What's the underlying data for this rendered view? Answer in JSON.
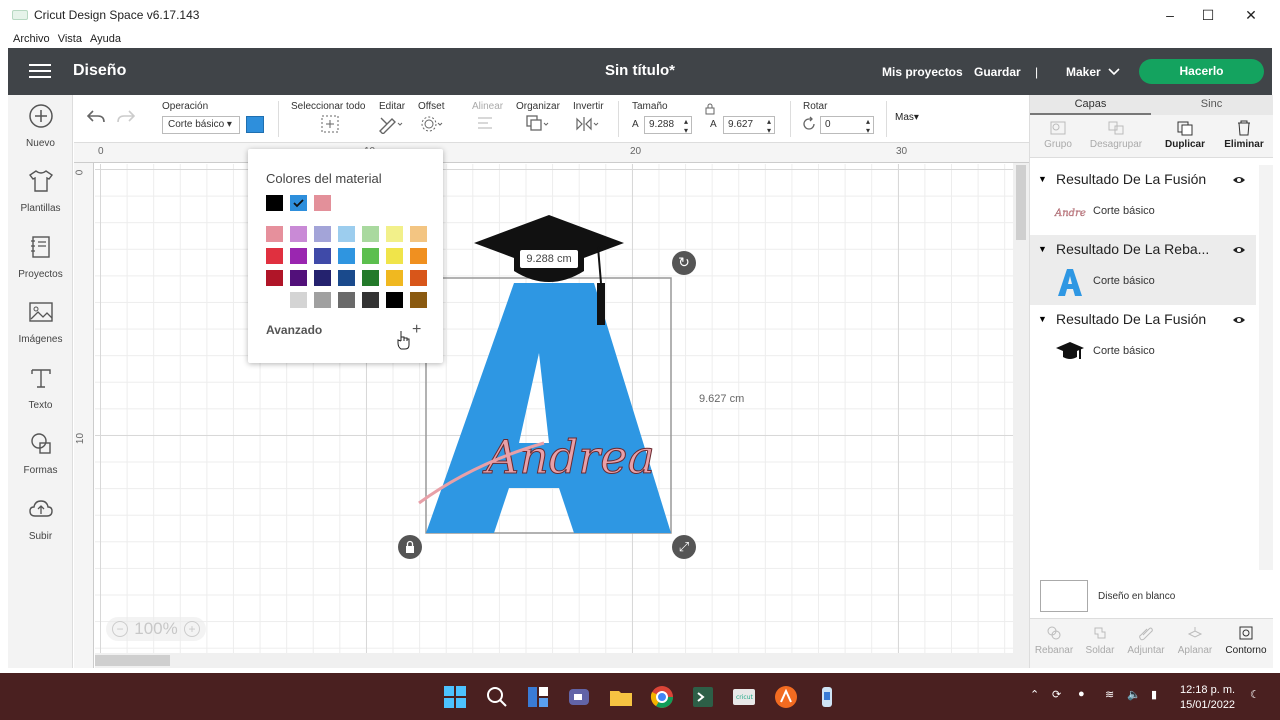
{
  "window": {
    "title": "Cricut Design Space  v6.17.143",
    "controls": [
      "minimize",
      "maximize",
      "close"
    ]
  },
  "menubar": [
    "Archivo",
    "Vista",
    "Ayuda"
  ],
  "header": {
    "section": "Diseño",
    "document_title": "Sin título*",
    "my_projects": "Mis proyectos",
    "save": "Guardar",
    "divider": "|",
    "machine": "Maker",
    "make_button": "Hacerlo",
    "accent_color": "#14a35f"
  },
  "sidebar": [
    {
      "label": "Nuevo",
      "icon": "plus-circle-icon"
    },
    {
      "label": "Plantillas",
      "icon": "shirt-icon"
    },
    {
      "label": "Proyectos",
      "icon": "notebook-icon"
    },
    {
      "label": "Imágenes",
      "icon": "image-icon"
    },
    {
      "label": "Texto",
      "icon": "text-icon"
    },
    {
      "label": "Formas",
      "icon": "shapes-icon"
    },
    {
      "label": "Subir",
      "icon": "cloud-upload-icon"
    }
  ],
  "toolbar": {
    "operation_label": "Operación",
    "operation_value": "Corte básico",
    "operation_color": "#2e8fdc",
    "select_all": "Seleccionar todo",
    "edit": "Editar",
    "offset": "Offset",
    "align": "Alinear",
    "arrange": "Organizar",
    "flip": "Invertir",
    "size_label": "Tamaño",
    "width_prefix": "A",
    "width_value": "9.288",
    "height_prefix": "A",
    "height_value": "9.627",
    "rotate_label": "Rotar",
    "rotate_value": "0",
    "more": "Mas"
  },
  "canvas": {
    "ruler_top": [
      "0",
      "10",
      "20",
      "30"
    ],
    "ruler_left": [
      "0",
      "10"
    ],
    "width_tag": "9.288 cm",
    "height_tag": "9.627 cm",
    "zoom": "100%",
    "letter_color": "#2e97e3",
    "script_text": "Andrea",
    "script_color": "#e8a0a8"
  },
  "color_popup": {
    "title": "Colores del material",
    "material_colors": [
      "#000000",
      "#2e8fdc",
      "#e3909a"
    ],
    "selected_index": 1,
    "palette": [
      [
        "#e6909c",
        "#c98ad6",
        "#a3a4d8",
        "#9ccdee",
        "#a9d99f",
        "#f2f08a",
        "#f3c582"
      ],
      [
        "#e0303f",
        "#9a26b0",
        "#3f4aa8",
        "#2f95e0",
        "#5cbf4e",
        "#f0e44a",
        "#f09020"
      ],
      [
        "#b01528",
        "#52107a",
        "#24226e",
        "#1a4a8c",
        "#237a2a",
        "#f0b820",
        "#d8561a"
      ],
      [
        "#ffffff",
        "#d4d4d4",
        "#a0a0a0",
        "#6a6a6a",
        "#333333",
        "#000000",
        "#8a5a10"
      ]
    ],
    "advanced": "Avanzado"
  },
  "right_panel": {
    "tabs": [
      "Capas",
      "Sinc"
    ],
    "actions": [
      {
        "label": "Grupo",
        "enabled": false
      },
      {
        "label": "Desagrupar",
        "enabled": false
      },
      {
        "label": "Duplicar",
        "enabled": true
      },
      {
        "label": "Eliminar",
        "enabled": true
      }
    ],
    "layers": [
      {
        "title": "Resultado De La Fusión",
        "operation": "Corte básico",
        "thumb": "andrea-script"
      },
      {
        "title": "Resultado De La Reba...",
        "operation": "Corte básico",
        "thumb": "letter-a"
      },
      {
        "title": "Resultado De La Fusión",
        "operation": "Corte básico",
        "thumb": "grad-cap"
      }
    ],
    "blank_canvas": "Diseño en blanco",
    "bottom_actions": [
      {
        "label": "Rebanar",
        "enabled": false
      },
      {
        "label": "Soldar",
        "enabled": false
      },
      {
        "label": "Adjuntar",
        "enabled": false
      },
      {
        "label": "Aplanar",
        "enabled": false
      },
      {
        "label": "Contorno",
        "enabled": true
      }
    ]
  },
  "taskbar": {
    "time": "12:18 p. m.",
    "date": "15/01/2022",
    "apps": [
      "windows-icon",
      "search-icon",
      "widgets-icon",
      "chat-icon",
      "file-explorer-icon",
      "chrome-icon",
      "terminal-icon",
      "cricut-icon",
      "app-icon",
      "app-icon"
    ]
  }
}
